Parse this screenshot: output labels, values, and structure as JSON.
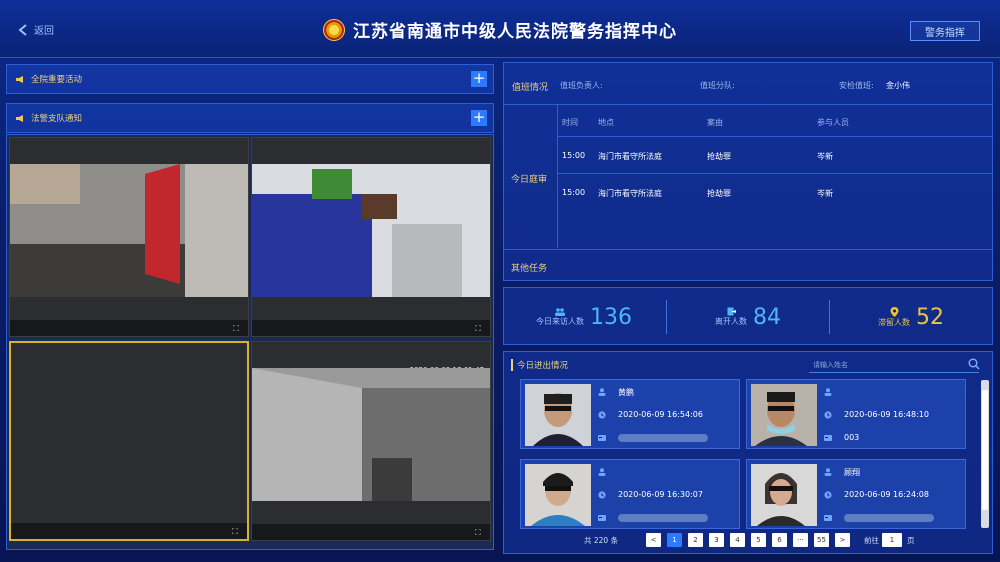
{
  "header": {
    "back_label": "返回",
    "title": "江苏省南通市中级人民法院警务指挥中心",
    "command_button": "警务指挥"
  },
  "left": {
    "bar1_label": "全院重要活动",
    "bar2_label": "法警支队通知",
    "cameras": [
      {
        "name": "camera-1",
        "timestamp": ""
      },
      {
        "name": "camera-2",
        "timestamp": ""
      },
      {
        "name": "camera-3",
        "timestamp": ""
      },
      {
        "name": "camera-4",
        "timestamp": "2020-06-09 17:01:47"
      }
    ]
  },
  "duty": {
    "section_label": "值班情况",
    "leader_label": "值班负责人:",
    "unit_label": "值班分队:",
    "checker_label": "安检值班:",
    "checker_value": "金小伟",
    "court_today_label": "今日庭审",
    "columns": [
      "时间",
      "地点",
      "案由",
      "参与人员"
    ],
    "rows": [
      {
        "time": "15:00",
        "place": "海门市看守所法庭",
        "cause": "抢劫罪",
        "people": "岑新"
      },
      {
        "time": "15:00",
        "place": "海门市看守所法庭",
        "cause": "抢劫罪",
        "people": "岑新"
      }
    ],
    "other_label": "其他任务"
  },
  "stats": {
    "visitors_label": "今日来访人数",
    "visitors_value": "136",
    "left_label": "离开人数",
    "left_value": "84",
    "stay_label": "滞留人数",
    "stay_value": "52"
  },
  "flow": {
    "title": "今日进出情况",
    "search_placeholder": "请输入姓名",
    "cards": [
      {
        "name": "黄鹏",
        "time": "2020-06-09 16:54:06",
        "id": ""
      },
      {
        "name": "",
        "time": "2020-06-09 16:48:10",
        "id": "003"
      },
      {
        "name": "",
        "time": "2020-06-09 16:30:07",
        "id": ""
      },
      {
        "name": "顾翔",
        "time": "2020-06-09 16:24:08",
        "id": ""
      }
    ],
    "pager": {
      "total": "共 220 条",
      "prev": "<",
      "pages": [
        "1",
        "2",
        "3",
        "4",
        "5",
        "6",
        "···",
        "55"
      ],
      "next": ">",
      "goto_label": "前往",
      "goto_value": "1",
      "page_suffix": "页"
    }
  },
  "colors": {
    "accent": "#2a7bff",
    "gold": "#e8d27a",
    "stat_blue": "#4fb3ff",
    "stat_yellow": "#f0c23a"
  }
}
